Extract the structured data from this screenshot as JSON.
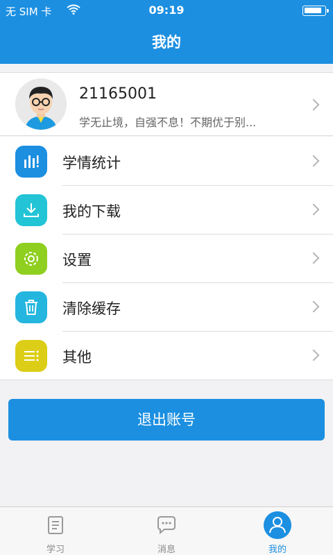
{
  "status_bar": {
    "carrier": "无 SIM 卡",
    "time": "09:19"
  },
  "header": {
    "title": "我的"
  },
  "profile": {
    "user_id": "21165001",
    "motto": "学无止境，自强不息！不期优于别..."
  },
  "menu": {
    "items": [
      {
        "label": "学情统计",
        "icon": "bar-chart-icon",
        "color": "#1c8fe1"
      },
      {
        "label": "我的下载",
        "icon": "download-icon",
        "color": "#22c4d6"
      },
      {
        "label": "设置",
        "icon": "gear-icon",
        "color": "#8fcf1f"
      },
      {
        "label": "清除缓存",
        "icon": "trash-icon",
        "color": "#24b6de"
      },
      {
        "label": "其他",
        "icon": "list-icon",
        "color": "#dccd17"
      }
    ]
  },
  "logout_label": "退出账号",
  "tabbar": {
    "tabs": [
      {
        "label": "学习",
        "icon": "book-icon"
      },
      {
        "label": "消息",
        "icon": "chat-icon"
      },
      {
        "label": "我的",
        "icon": "user-icon",
        "active": true
      }
    ]
  },
  "colors": {
    "primary": "#1c8fe1",
    "page_bg": "#f2f2f4"
  }
}
